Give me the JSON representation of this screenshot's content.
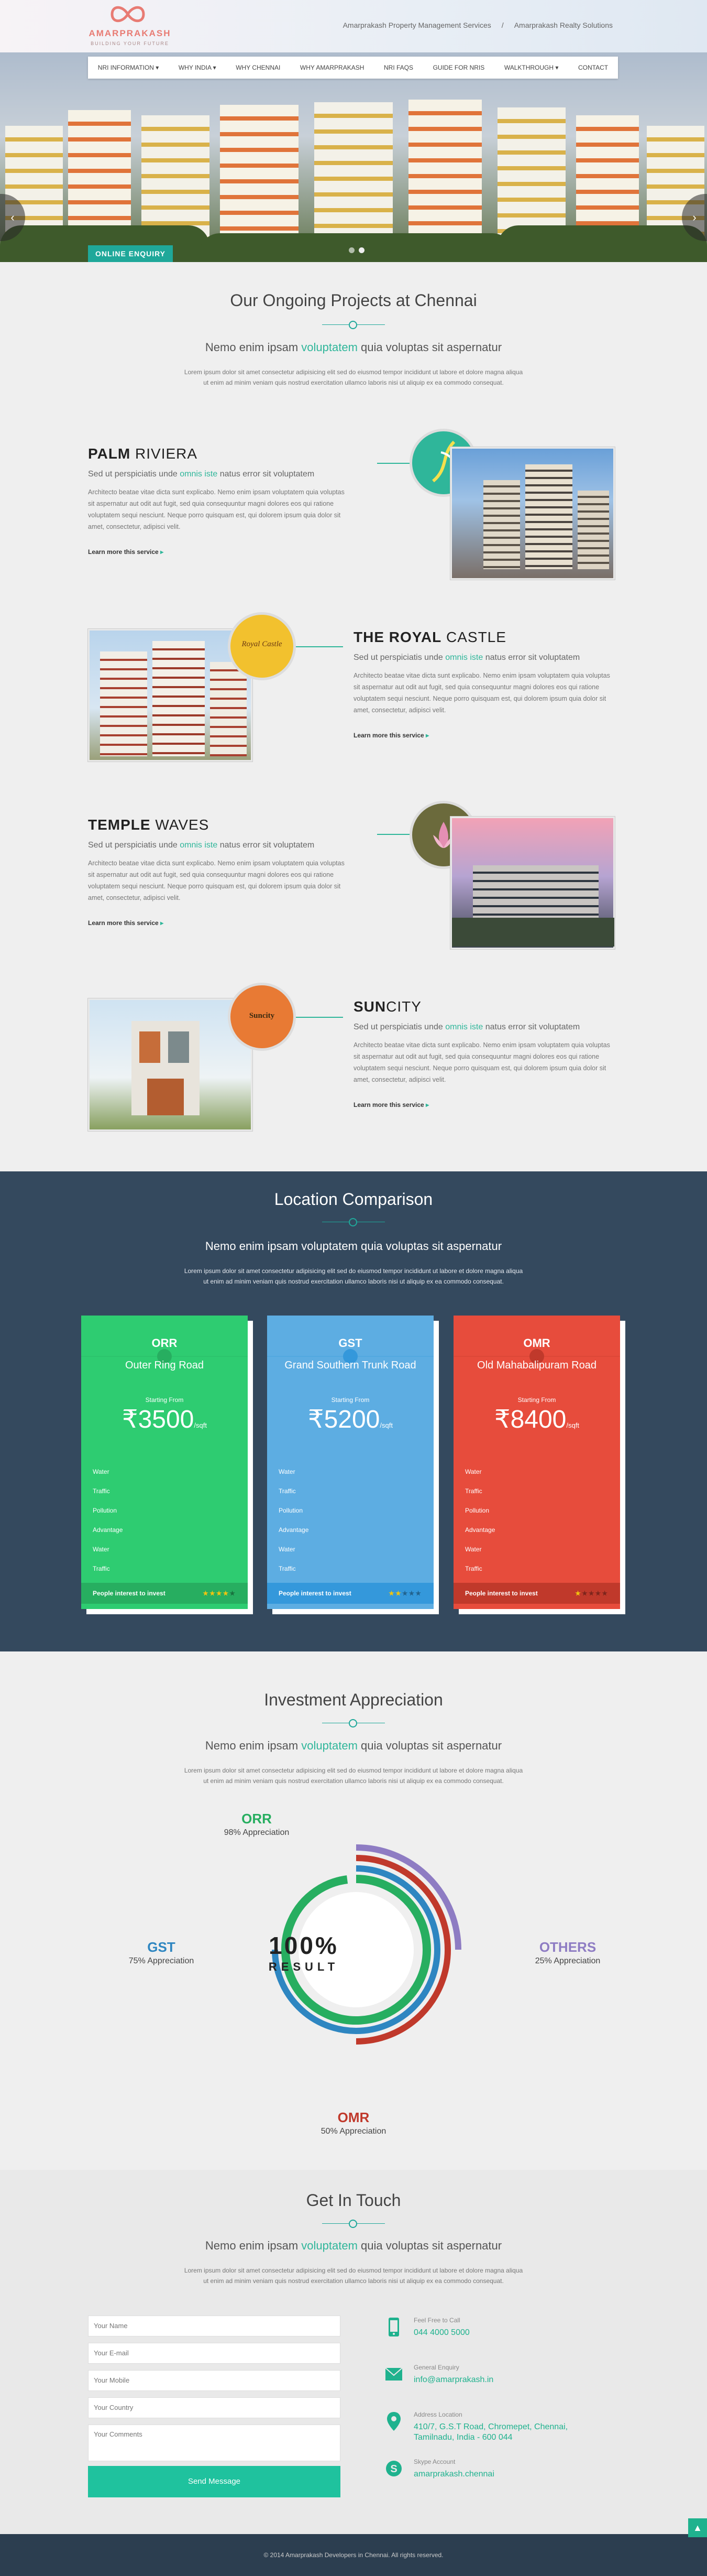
{
  "header": {
    "brand": "AMARPRAKASH",
    "tagline": "BUILDING YOUR FUTURE",
    "top_links": [
      "Amarprakash Property Management Services",
      "/",
      "Amarprakash Realty Solutions"
    ]
  },
  "nav": {
    "items": [
      "NRI INFORMATION ▾",
      "WHY INDIA ▾",
      "WHY CHENNAI",
      "WHY AMARPRAKASH",
      "NRI FAQS",
      "GUIDE FOR NRIS",
      "WALKTHROUGH ▾",
      "CONTACT"
    ]
  },
  "hero": {
    "enquiry_label": "ONLINE ENQUIRY",
    "prev": "‹",
    "next": "›"
  },
  "projects_section": {
    "title": "Our Ongoing Projects at Chennai",
    "sub_pre": "Nemo enim ipsam ",
    "sub_hl": "voluptatem",
    "sub_post": " quia voluptas sit aspernatur",
    "lorem": "Lorem ipsum dolor sit amet consectetur adipisicing elit sed do eiusmod tempor incididunt ut labore et dolore magna aliqua ut enim ad minim veniam quis nostrud exercitation ullamco laboris nisi ut aliquip ex ea commodo consequat.",
    "projects": [
      {
        "title_a": "PALM",
        "title_b": " RIVIERA",
        "sub_pre": "Sed ut perspiciatis unde ",
        "sub_hl": "omnis iste",
        "sub_post": " natus error sit voluptatem",
        "body": "Architecto beatae vitae dicta sunt explicabo. Nemo enim ipsam voluptatem quia voluptas sit aspernatur aut odit aut fugit, sed quia consequuntur magni dolores eos qui ratione voluptatem sequi nesciunt. Neque porro quisquam est, qui dolorem ipsum quia dolor sit amet, consectetur, adipisci velit.",
        "link": "Learn more this service",
        "link_arrow": "▸"
      },
      {
        "title_a": "THE ROYAL",
        "title_b": " CASTLE",
        "sub_pre": "Sed ut perspiciatis unde ",
        "sub_hl": "omnis iste",
        "sub_post": " natus error sit voluptatem",
        "body": "Architecto beatae vitae dicta sunt explicabo. Nemo enim ipsam voluptatem quia voluptas sit aspernatur aut odit aut fugit, sed quia consequuntur magni dolores eos qui ratione voluptatem sequi nesciunt. Neque porro quisquam est, qui dolorem ipsum quia dolor sit amet, consectetur, adipisci velit.",
        "link": "Learn more this service",
        "link_arrow": "▸",
        "badge_text": "Royal Castle"
      },
      {
        "title_a": "TEMPLE",
        "title_b": " WAVES",
        "sub_pre": "Sed ut perspiciatis unde ",
        "sub_hl": "omnis iste",
        "sub_post": " natus error sit voluptatem",
        "body": "Architecto beatae vitae dicta sunt explicabo. Nemo enim ipsam voluptatem quia voluptas sit aspernatur aut odit aut fugit, sed quia consequuntur magni dolores eos qui ratione voluptatem sequi nesciunt. Neque porro quisquam est, qui dolorem ipsum quia dolor sit amet, consectetur, adipisci velit.",
        "link": "Learn more this service",
        "link_arrow": "▸"
      },
      {
        "title_a": "SUN",
        "title_b": "CITY",
        "sub_pre": "Sed ut perspiciatis unde ",
        "sub_hl": "omnis iste",
        "sub_post": " natus error sit voluptatem",
        "body": "Architecto beatae vitae dicta sunt explicabo. Nemo enim ipsam voluptatem quia voluptas sit aspernatur aut odit aut fugit, sed quia consequuntur magni dolores eos qui ratione voluptatem sequi nesciunt. Neque porro quisquam est, qui dolorem ipsum quia dolor sit amet, consectetur, adipisci velit.",
        "link": "Learn more this service",
        "link_arrow": "▸",
        "badge_text": "Suncity"
      }
    ]
  },
  "location": {
    "title": "Location Comparison",
    "sub": "Nemo enim ipsam voluptatem quia voluptas sit aspernatur",
    "lorem": "Lorem ipsum dolor sit amet consectetur adipisicing elit sed do eiusmod tempor incididunt ut labore et dolore magna aliqua ut enim ad minim veniam quis nostrud exercitation ullamco laboris nisi ut aliquip ex ea commodo consequat.",
    "cards": [
      {
        "code": "ORR",
        "name": "Outer Ring Road",
        "starting": "Starting From",
        "price": "₹3500",
        "unit": "/sqft",
        "color": "#2ecc71",
        "dark": "#27ae60",
        "features": [
          "Water",
          "Traffic",
          "Pollution",
          "Advantage",
          "Water",
          "Traffic"
        ],
        "foot": "People interest to invest",
        "rating": 4
      },
      {
        "code": "GST",
        "name": "Grand Southern Trunk Road",
        "starting": "Starting From",
        "price": "₹5200",
        "unit": "/sqft",
        "color": "#5dade2",
        "dark": "#3498db",
        "features": [
          "Water",
          "Traffic",
          "Pollution",
          "Advantage",
          "Water",
          "Traffic"
        ],
        "foot": "People interest to invest",
        "rating": 2
      },
      {
        "code": "OMR",
        "name": "Old Mahabalipuram Road",
        "starting": "Starting From",
        "price": "₹8400",
        "unit": "/sqft",
        "color": "#e74c3c",
        "dark": "#c0392b",
        "features": [
          "Water",
          "Traffic",
          "Pollution",
          "Advantage",
          "Water",
          "Traffic"
        ],
        "foot": "People interest to invest",
        "rating": 1
      }
    ]
  },
  "investment": {
    "title": "Investment Appreciation",
    "sub_pre": "Nemo enim ipsam ",
    "sub_hl": "voluptatem",
    "sub_post": " quia voluptas sit aspernatur",
    "lorem": "Lorem ipsum dolor sit amet consectetur adipisicing elit sed do eiusmod tempor incididunt ut labore et dolore magna aliqua ut enim ad minim veniam quis nostrud exercitation ullamco laboris nisi ut aliquip ex ea commodo consequat.",
    "center_big": "100%",
    "center_small": "RESULT",
    "rings": [
      {
        "code": "ORR",
        "text": "98% Appreciation",
        "value": 98,
        "color": "#27ae60"
      },
      {
        "code": "GST",
        "text": "75% Appreciation",
        "value": 75,
        "color": "#2e86c1"
      },
      {
        "code": "OMR",
        "text": "50% Appreciation",
        "value": 50,
        "color": "#c0392b"
      },
      {
        "code": "OTHERS",
        "text": "25% Appreciation",
        "value": 25,
        "color": "#8e7cc3"
      }
    ]
  },
  "contact": {
    "title": "Get In Touch",
    "sub_pre": "Nemo enim ipsam ",
    "sub_hl": "voluptatem",
    "sub_post": " quia voluptas sit aspernatur",
    "lorem": "Lorem ipsum dolor sit amet consectetur adipisicing elit sed do eiusmod tempor incididunt ut labore et dolore magna aliqua ut enim ad minim veniam quis nostrud exercitation ullamco laboris nisi ut aliquip ex ea commodo consequat.",
    "placeholders": {
      "name": "Your Name",
      "email": "Your E-mail",
      "mobile": "Your Mobile",
      "country": "Your Country",
      "comments": "Your Comments"
    },
    "send": "Send Message",
    "info": [
      {
        "title": "Feel Free to Call",
        "value": "044 4000 5000",
        "icon": "phone-icon"
      },
      {
        "title": "General Enquiry",
        "value": "info@amarprakash.in",
        "icon": "mail-icon"
      },
      {
        "title": "Address Location",
        "value": "410/7, G.S.T Road, Chromepet, Chennai,",
        "value2": "Tamilnadu, India - 600 044",
        "icon": "location-icon"
      },
      {
        "title": "Skype Account",
        "value": "amarprakash.chennai",
        "icon": "skype-icon"
      }
    ]
  },
  "footer": {
    "text": "© 2014 Amarprakash Developers in Chennai. All rights reserved.",
    "totop": "▲"
  }
}
